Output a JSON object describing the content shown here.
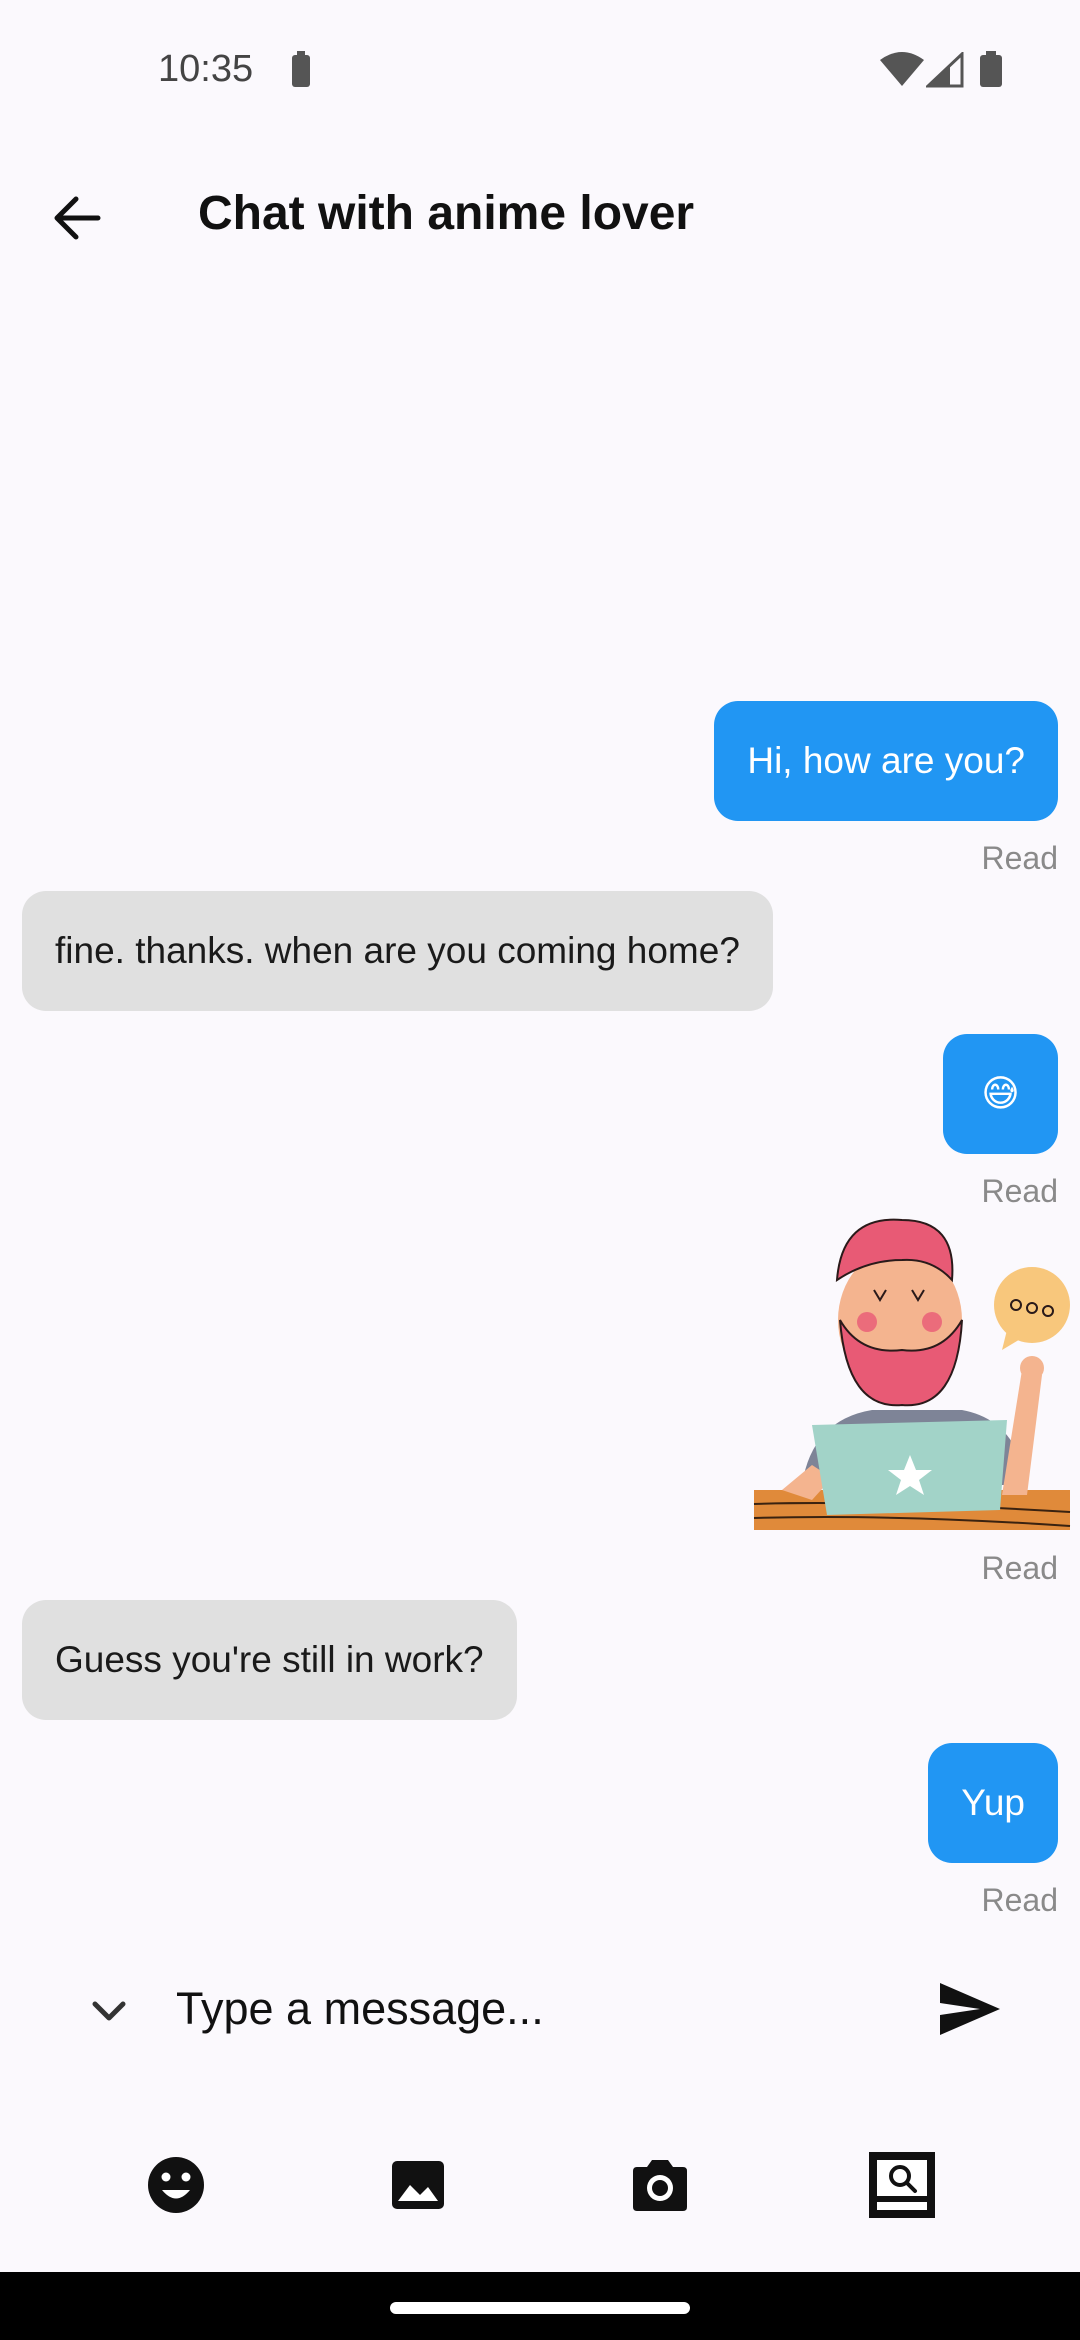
{
  "status_bar": {
    "time": "10:35"
  },
  "header": {
    "title": "Chat with anime lover"
  },
  "messages": [
    {
      "text": "Hi, how are you?",
      "status": "Read"
    },
    {
      "text": "fine. thanks. when are you coming home?"
    },
    {
      "text": "😅",
      "status": "Read"
    },
    {
      "sticker": "man-on-laptop-thinking",
      "status": "Read"
    },
    {
      "text": "Guess you're still in work?"
    },
    {
      "text": "Yup",
      "status": "Read"
    }
  ],
  "composer": {
    "placeholder": "Type a message..."
  },
  "toolbar": {
    "icons": [
      "emoji-icon",
      "image-icon",
      "camera-icon",
      "screen-share-icon"
    ]
  },
  "colors": {
    "outgoing": "#2196f3",
    "incoming": "#e0e0e0",
    "background": "#fbf9fd"
  }
}
